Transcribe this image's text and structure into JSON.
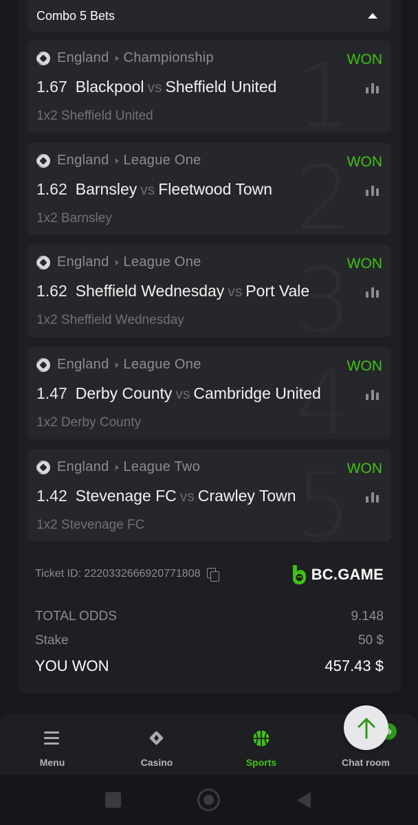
{
  "combo": {
    "title": "Combo 5 Bets"
  },
  "bets": [
    {
      "number": "1",
      "country": "England",
      "league": "Championship",
      "status": "WON",
      "odds": "1.67",
      "home": "Blackpool",
      "vs": "vs",
      "away": "Sheffield United",
      "selection": "1x2 Sheffield United"
    },
    {
      "number": "2",
      "country": "England",
      "league": "League One",
      "status": "WON",
      "odds": "1.62",
      "home": "Barnsley",
      "vs": "vs",
      "away": "Fleetwood Town",
      "selection": "1x2 Barnsley"
    },
    {
      "number": "3",
      "country": "England",
      "league": "League One",
      "status": "WON",
      "odds": "1.62",
      "home": "Sheffield Wednesday",
      "vs": "vs",
      "away": "Port Vale",
      "selection": "1x2 Sheffield Wednesday"
    },
    {
      "number": "4",
      "country": "England",
      "league": "League One",
      "status": "WON",
      "odds": "1.47",
      "home": "Derby County",
      "vs": "vs",
      "away": "Cambridge United",
      "selection": "1x2 Derby County"
    },
    {
      "number": "5",
      "country": "England",
      "league": "League Two",
      "status": "WON",
      "odds": "1.42",
      "home": "Stevenage FC",
      "vs": "vs",
      "away": "Crawley Town",
      "selection": "1x2 Stevenage FC"
    }
  ],
  "ticket": {
    "label": "Ticket ID: 2220332666920771808"
  },
  "brand": {
    "name": "BC.GAME",
    "color": "#3fc214"
  },
  "summary": {
    "total_odds_label": "TOTAL ODDS",
    "total_odds_value": "9.148",
    "stake_label": "Stake",
    "stake_value": "50 $",
    "won_label": "YOU WON",
    "won_value": "457.43 $"
  },
  "nav": [
    {
      "label": "Menu",
      "icon": "hamburger-icon"
    },
    {
      "label": "Casino",
      "icon": "cards-icon"
    },
    {
      "label": "Sports",
      "icon": "basketball-icon",
      "active": true
    },
    {
      "label": "Chat room",
      "icon": "chat-icon"
    }
  ],
  "colors": {
    "won_green": "#3fc214",
    "background": "#17181b",
    "card": "#26272b"
  }
}
